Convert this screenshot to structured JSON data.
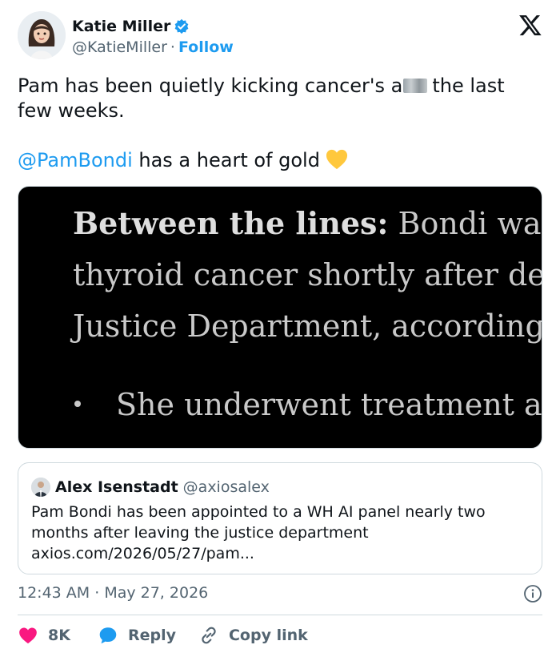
{
  "author": {
    "display_name": "Katie Miller",
    "handle": "@KatieMiller",
    "separator": "·",
    "follow_label": "Follow",
    "verified_icon": "verified-badge-icon",
    "brand_icon": "x-logo-icon"
  },
  "tweet": {
    "line1_before_censor": "Pam has been quietly kicking cancer's a",
    "line1_after_censor": "the last",
    "line2": "few weeks.",
    "mention": "@PamBondi",
    "line3_rest": " has a heart of gold",
    "emoji": "yellow-heart-icon"
  },
  "media": {
    "line1_bold": "Between the lines:",
    "line1_rest": " Bondi was di",
    "line2": "thyroid cancer shortly after depa",
    "line3": "Justice Department, according to",
    "bullet": "She underwent treatment and"
  },
  "quote": {
    "name": "Alex Isenstadt",
    "handle": "@axiosalex",
    "body_line1": "Pam Bondi has been appointed to a WH AI panel nearly two",
    "body_line2": "months after leaving the justice department",
    "link": "axios.com/2026/05/27/pam..."
  },
  "meta": {
    "time": "12:43 AM",
    "separator": " · ",
    "date": "May 27, 2026"
  },
  "actions": {
    "like_count": "8K",
    "reply_label": "Reply",
    "copy_label": "Copy link"
  },
  "colors": {
    "accent": "#1d9bf0",
    "like": "#f91880",
    "text": "#0f1419",
    "muted": "#536471",
    "border": "#cfd9de"
  }
}
